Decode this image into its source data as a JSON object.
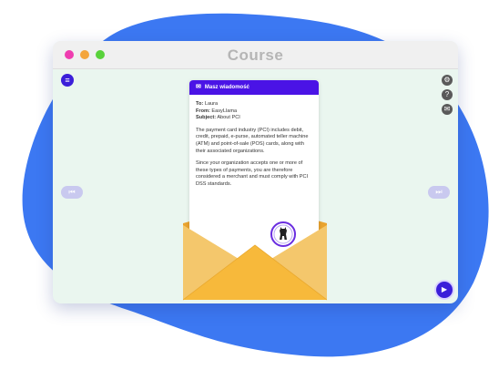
{
  "window": {
    "title": "Course"
  },
  "message": {
    "header": "Masz wiadomość",
    "to_label": "To:",
    "to_value": "Laura",
    "from_label": "From:",
    "from_value": "EasyLlama",
    "subject_label": "Subject:",
    "subject_value": "About PCI",
    "paragraph1": "The payment card industry (PCI) includes debit, credit, prepaid, e-purse, automated teller machine (ATM) and point-of-sale (POS) cards, along with their associated organizations.",
    "paragraph2": "Since your organization accepts one or more of these types of payments, you are therefore considered a merchant and must comply with PCI DSS standards."
  },
  "icons": {
    "menu": "menu-icon",
    "settings": "gear-icon",
    "help": "question-icon",
    "captions": "chat-icon",
    "prev": "skip-back-icon",
    "next": "skip-forward-icon",
    "play": "play-icon",
    "seal": "llama-seal-icon",
    "mail": "mail-icon"
  },
  "colors": {
    "accent": "#3b1fd9",
    "blob": "#3c78f2",
    "stage": "#eaf6ef",
    "envelope": "#f7b93b"
  }
}
